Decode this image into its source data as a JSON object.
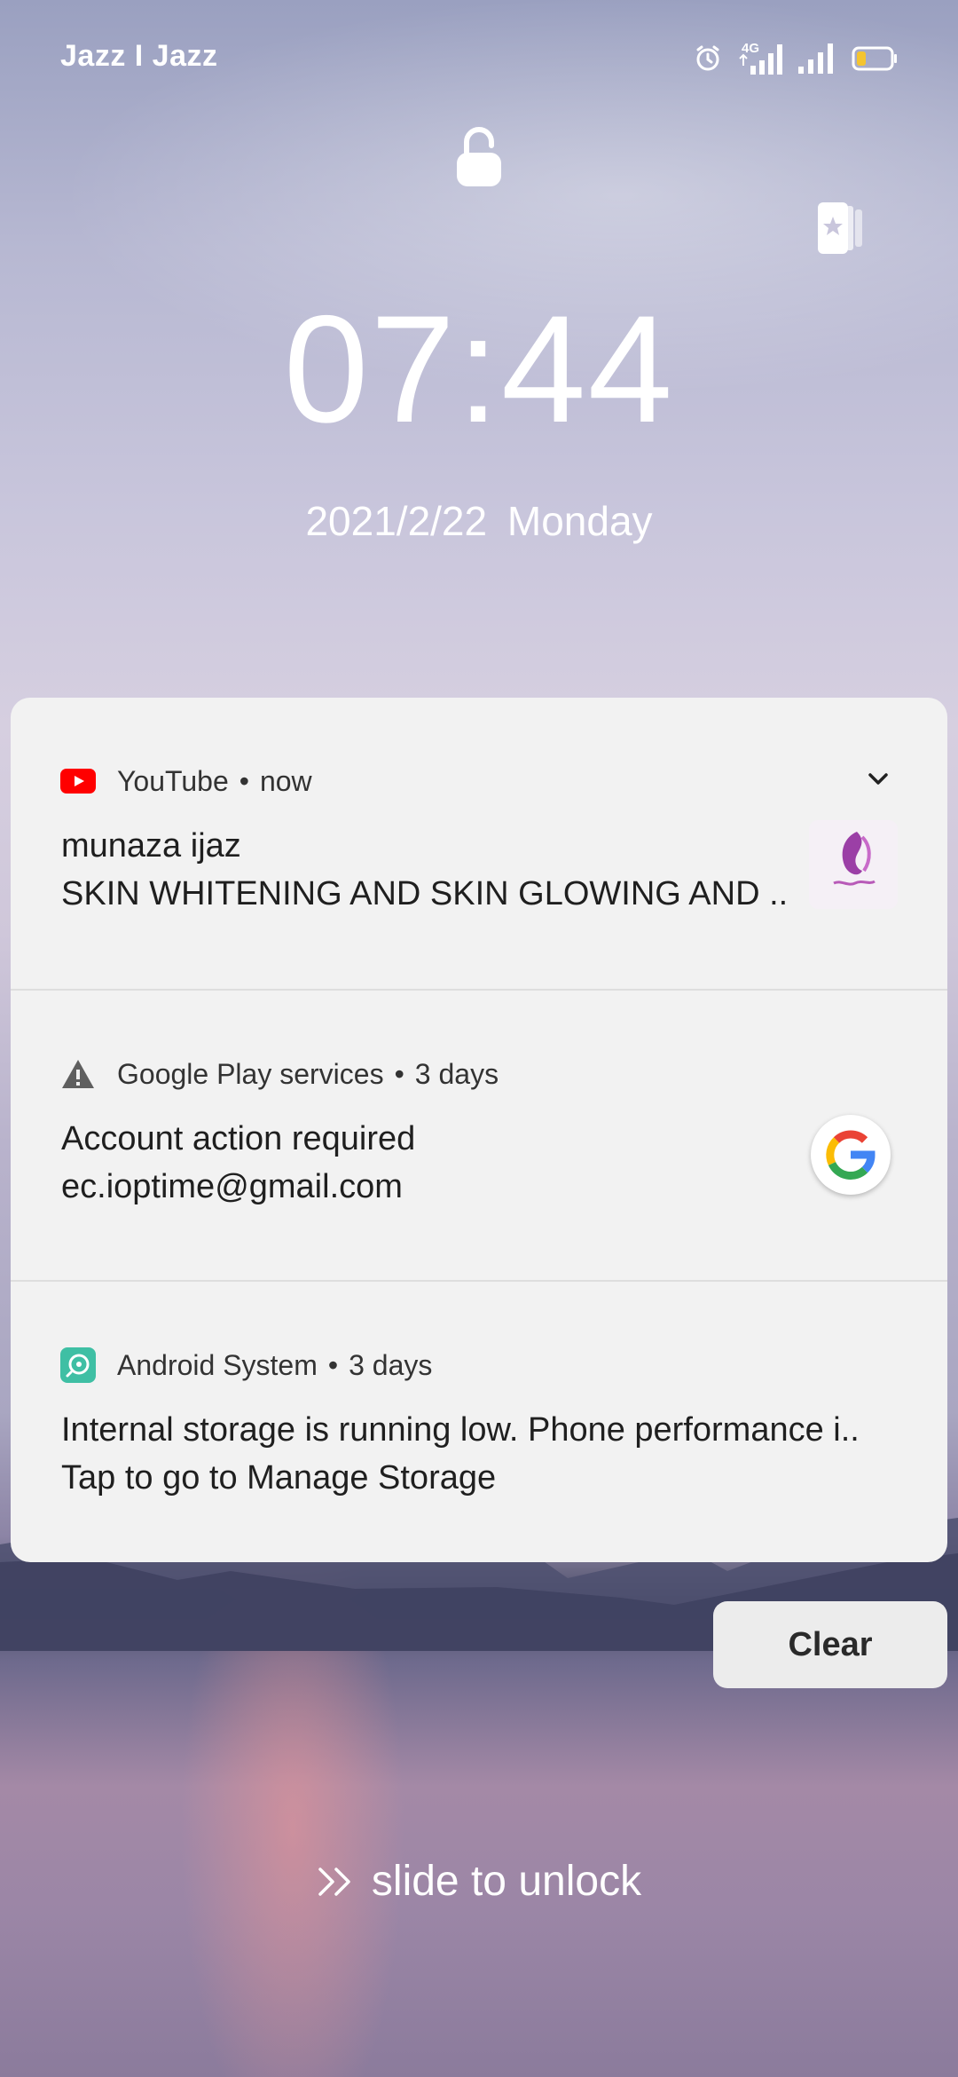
{
  "status_bar": {
    "carrier": "Jazz I Jazz",
    "network_type": "4G",
    "icons": [
      "alarm-icon",
      "signal-4g-icon",
      "signal-icon",
      "battery-low-icon"
    ],
    "battery_color": "#f4c430"
  },
  "lockscreen": {
    "time": "07:44",
    "date": "2021/2/22",
    "weekday": "Monday",
    "slide_label": "slide to unlock",
    "clear_label": "Clear"
  },
  "notifications": [
    {
      "app": "YouTube",
      "time": "now",
      "title": "munaza ijaz",
      "body": "SKIN WHITENING AND SKIN GLOWING AND ..",
      "icon": "youtube-icon",
      "accent": "#ff0000"
    },
    {
      "app": "Google Play services",
      "time": "3 days",
      "title": "Account action required",
      "body": "ec.ioptime@gmail.com",
      "icon": "warning-icon"
    },
    {
      "app": "Android System",
      "time": "3 days",
      "title": "Internal storage is running low. Phone performance i..",
      "body": "Tap to go to Manage Storage",
      "icon": "android-system-icon",
      "accent": "#3fbfa4"
    }
  ]
}
